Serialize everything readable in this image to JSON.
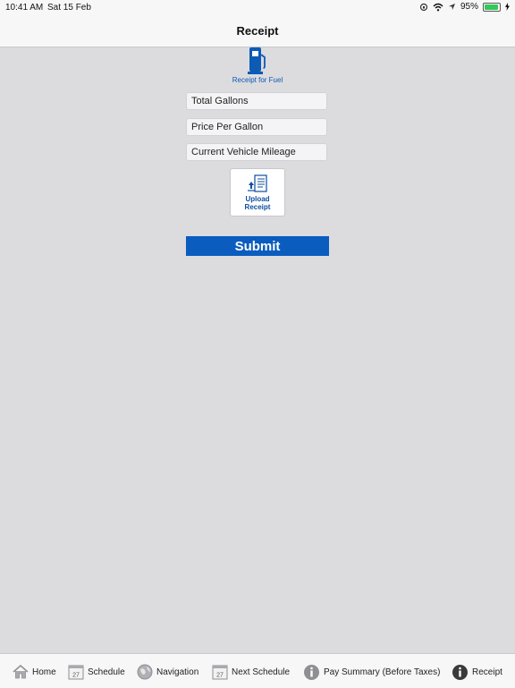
{
  "status_bar": {
    "time": "10:41 AM",
    "date": "Sat 15 Feb",
    "battery": "95%",
    "battery_level": 0.95
  },
  "navbar": {
    "title": "Receipt"
  },
  "fuel": {
    "caption": "Receipt for Fuel"
  },
  "form": {
    "total_gallons_placeholder": "Total Gallons",
    "price_per_gallon_placeholder": "Price Per Gallon",
    "mileage_placeholder": "Current Vehicle Mileage",
    "upload_label_line1": "Upload",
    "upload_label_line2": "Receipt",
    "submit_label": "Submit"
  },
  "tabs": [
    {
      "label": "Home",
      "icon": "home-icon"
    },
    {
      "label": "Schedule",
      "icon": "calendar-icon",
      "icon_text": "27"
    },
    {
      "label": "Navigation",
      "icon": "globe-icon"
    },
    {
      "label": "Next Schedule",
      "icon": "calendar-icon",
      "icon_text": "27"
    },
    {
      "label": "Pay Summary (Before Taxes)",
      "icon": "info-icon"
    },
    {
      "label": "Receipt",
      "icon": "info-icon",
      "active": true
    }
  ],
  "colors": {
    "accent": "#0a5cbf",
    "background": "#dcdbde",
    "battery": "#34c759"
  }
}
